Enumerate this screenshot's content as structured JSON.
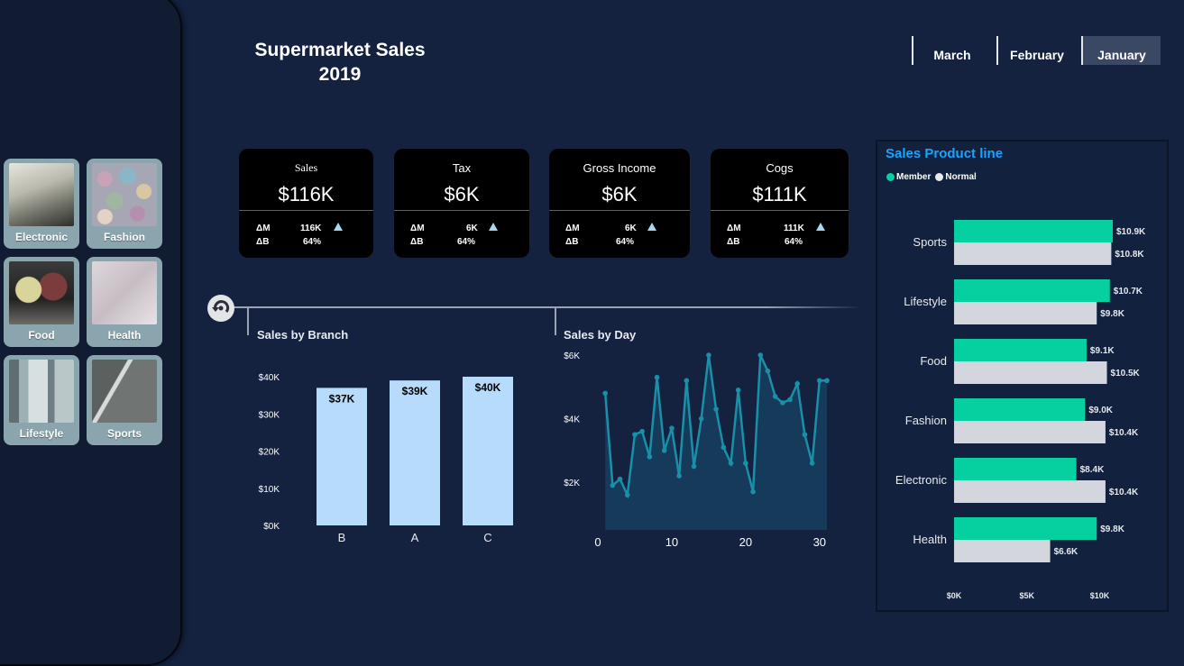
{
  "sidebar": {
    "items": [
      {
        "label": "Electronic",
        "icon": "electronic-photo"
      },
      {
        "label": "Fashion",
        "icon": "buttons-photo"
      },
      {
        "label": "Food",
        "icon": "fruit-photo"
      },
      {
        "label": "Health",
        "icon": "masks-photo"
      },
      {
        "label": "Lifestyle",
        "icon": "window-photo"
      },
      {
        "label": "Sports",
        "icon": "ball-photo"
      }
    ]
  },
  "header": {
    "title_line1": "Supermarket Sales",
    "title_line2": "2019"
  },
  "months": {
    "march": "March",
    "february": "February",
    "january": "January",
    "selected": "January"
  },
  "kpis": [
    {
      "title": "Sales",
      "value": "$116K",
      "dm_label": "ΔM",
      "dm_value": "116K",
      "db_label": "ΔB",
      "db_value": "64%"
    },
    {
      "title": "Tax",
      "value": "$6K",
      "dm_label": "ΔM",
      "dm_value": "6K",
      "db_label": "ΔB",
      "db_value": "64%"
    },
    {
      "title": "Gross Income",
      "value": "$6K",
      "dm_label": "ΔM",
      "dm_value": "6K",
      "db_label": "ΔB",
      "db_value": "64%"
    },
    {
      "title": "Cogs",
      "value": "$111K",
      "dm_label": "ΔM",
      "dm_value": "111K",
      "db_label": "ΔB",
      "db_value": "64%"
    }
  ],
  "colors": {
    "background": "#142240",
    "branch_bar": "#b7dbfb",
    "day_line": "#1a8fa8",
    "member": "#06cfa0",
    "normal": "#d3d6dc",
    "product_title": "#1aa3ff"
  },
  "chart_data": [
    {
      "type": "bar",
      "title": "Sales by Branch",
      "categories": [
        "B",
        "A",
        "C"
      ],
      "values": [
        37,
        39,
        40
      ],
      "data_labels": [
        "$37K",
        "$39K",
        "$40K"
      ],
      "yticks": [
        "$0K",
        "$10K",
        "$20K",
        "$30K",
        "$40K"
      ],
      "ylim": [
        0,
        40
      ]
    },
    {
      "type": "area",
      "title": "Sales by Day",
      "x": [
        1,
        2,
        3,
        4,
        5,
        6,
        7,
        8,
        9,
        10,
        11,
        12,
        13,
        14,
        15,
        16,
        17,
        18,
        19,
        20,
        21,
        22,
        23,
        24,
        25,
        26,
        27,
        28,
        29,
        30,
        31
      ],
      "y": [
        4.8,
        1.9,
        2.1,
        1.6,
        3.5,
        3.6,
        2.8,
        5.3,
        3.0,
        3.7,
        2.2,
        5.2,
        2.5,
        4.0,
        6.0,
        4.3,
        3.1,
        2.6,
        4.9,
        2.6,
        1.7,
        6.0,
        5.5,
        4.7,
        4.5,
        4.6,
        5.1,
        3.5,
        2.6,
        5.2,
        5.2
      ],
      "xticks": [
        "0",
        "10",
        "20",
        "30"
      ],
      "yticks": [
        "$2K",
        "$4K",
        "$6K"
      ],
      "xlim": [
        0,
        31
      ],
      "ylim": [
        0.5,
        6.2
      ]
    },
    {
      "type": "bar",
      "orientation": "horizontal",
      "title": "Sales Product line",
      "categories": [
        "Sports",
        "Lifestyle",
        "Food",
        "Fashion",
        "Electronic",
        "Health"
      ],
      "series": [
        {
          "name": "Member",
          "values": [
            10.9,
            10.7,
            9.1,
            9.0,
            8.4,
            9.8
          ],
          "labels": [
            "$10.9K",
            "$10.7K",
            "$9.1K",
            "$9.0K",
            "$8.4K",
            "$9.8K"
          ]
        },
        {
          "name": "Normal",
          "values": [
            10.8,
            9.8,
            10.5,
            10.4,
            10.4,
            6.6
          ],
          "labels": [
            "$10.8K",
            "$9.8K",
            "$10.5K",
            "$10.4K",
            "$10.4K",
            "$6.6K"
          ]
        }
      ],
      "xticks": [
        "$0K",
        "$5K",
        "$10K"
      ],
      "xlim": [
        0,
        10.9
      ]
    }
  ]
}
